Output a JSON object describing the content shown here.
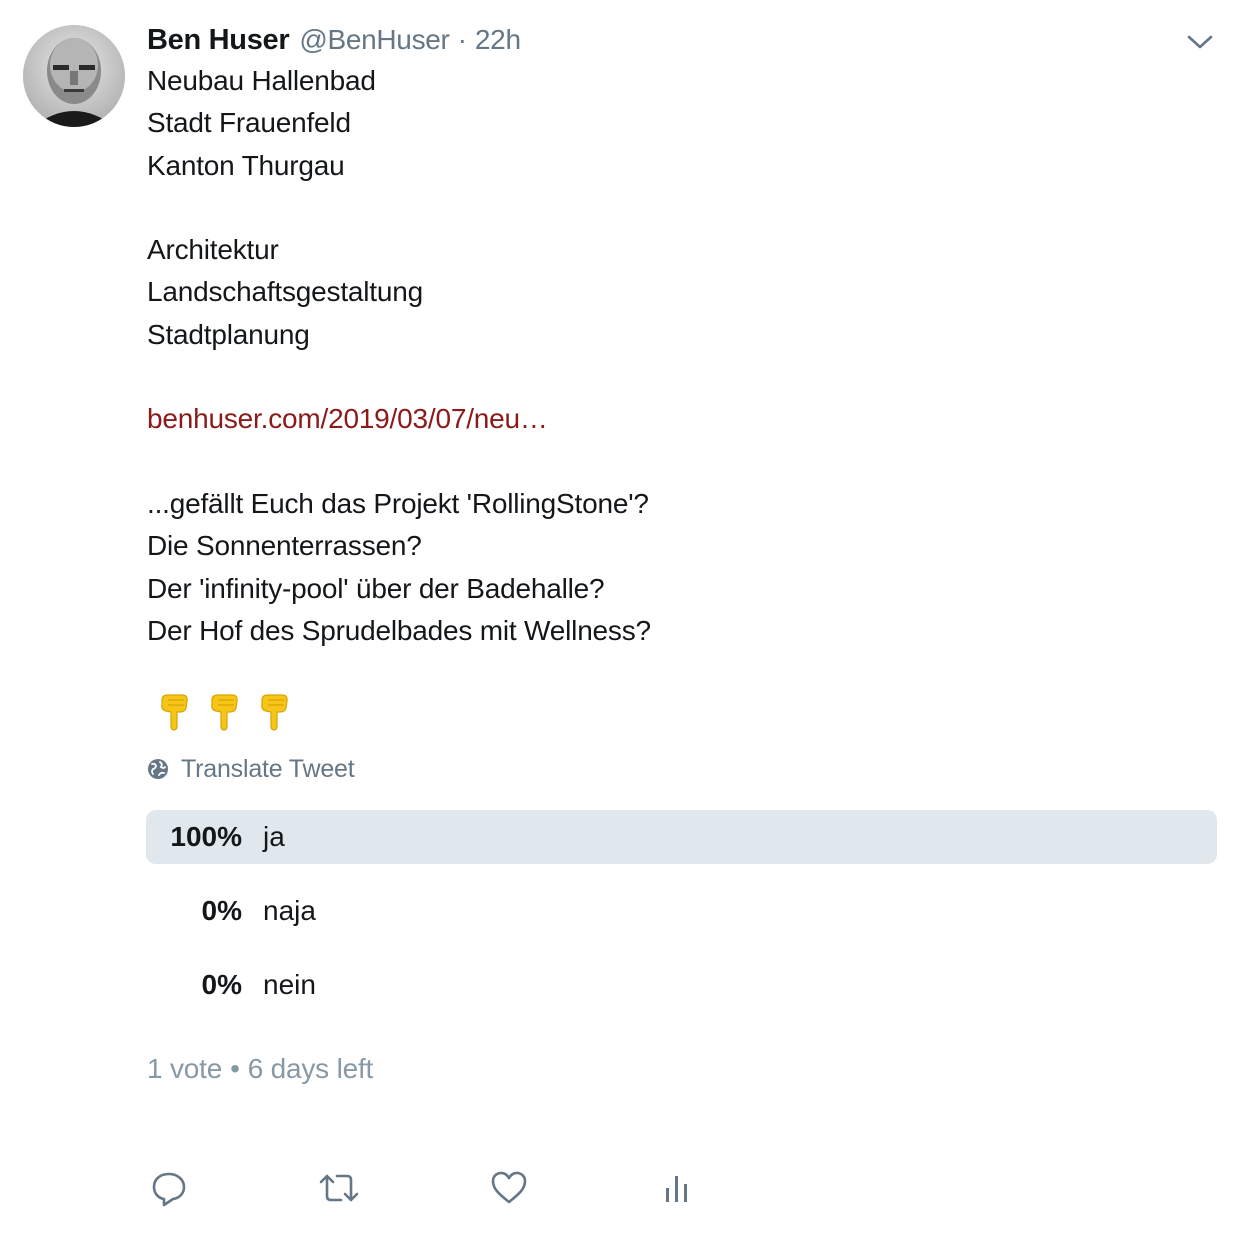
{
  "tweet": {
    "author_name": "Ben Huser",
    "author_handle": "@BenHuser",
    "separator": "·",
    "timestamp": "22h",
    "lines": [
      "Neubau Hallenbad",
      "Stadt Frauenfeld",
      "Kanton Thurgau",
      "",
      "Architektur",
      "Landschaftsgestaltung",
      "Stadtplanung",
      "",
      "",
      "",
      "...gefällt Euch das Projekt 'RollingStone'?",
      "Die Sonnenterrassen?",
      "Der 'infinity-pool' über der Badehalle?",
      "Der Hof des Sprudelbades mit Wellness?"
    ],
    "link_text": "benhuser.com/2019/03/07/neu…",
    "translate_label": "Translate Tweet"
  },
  "icons": {
    "avatar": "avatar-photo",
    "caret": "chevron-down-icon",
    "emoji": "backhand-index-pointing-down-icon",
    "translate": "globe-icon",
    "reply": "reply-icon",
    "retweet": "retweet-icon",
    "like": "heart-icon",
    "analytics": "analytics-icon"
  },
  "poll": {
    "options": [
      {
        "percent": "100%",
        "label": "ja",
        "fraction": 1.0,
        "winner": true
      },
      {
        "percent": "0%",
        "label": "naja",
        "fraction": 0.0,
        "winner": false
      },
      {
        "percent": "0%",
        "label": "nein",
        "fraction": 0.0,
        "winner": false
      }
    ],
    "votes": "1 vote",
    "bullet": "•",
    "time_left": "6 days left"
  },
  "colors": {
    "text": "#14171a",
    "secondary": "#657786",
    "link": "#8b1a1a",
    "poll_bar": "#e1e8ed",
    "meta": "#8899a6",
    "emoji": "#f5c518"
  }
}
